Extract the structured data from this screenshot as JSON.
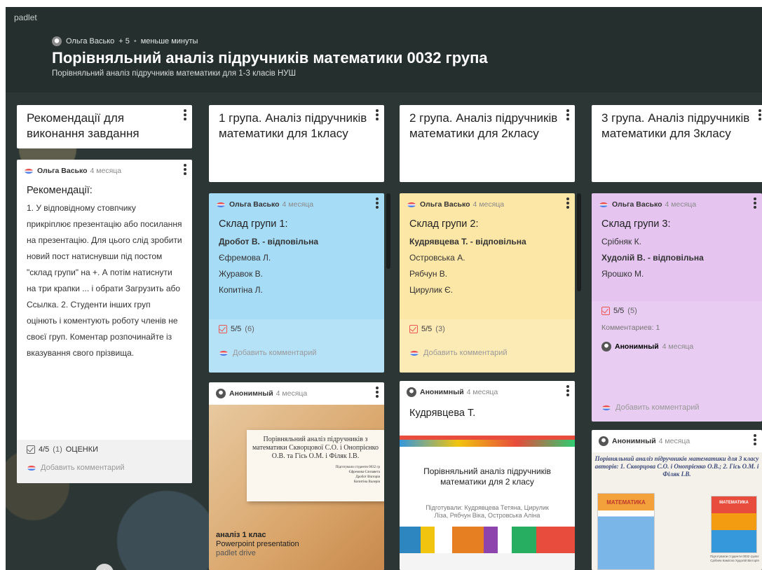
{
  "brand": "padlet",
  "header": {
    "author": "Ольга Васько",
    "contributors": "+ 5",
    "updated": "меньше минуты",
    "title": "Порівняльний аналіз підручників математики 0032 група",
    "subtitle": "Порівняльний аналіз підручників математики для 1-3 класів НУШ"
  },
  "columns": [
    {
      "title": "Рекомендації для виконання завдання"
    },
    {
      "title": "1 група. Аналіз підручників математики для 1класу"
    },
    {
      "title": "2 група. Аналіз підручників математики для 2класу"
    },
    {
      "title": "3 група. Аналіз підручників математики для 3класу"
    }
  ],
  "cards": {
    "rec": {
      "author": "Ольга Васько",
      "time": "4 месяца",
      "title": "Рекомендації:",
      "body": "1. У відповідному стовпчику прикріплює презентацію або посилання на презентацію. Для цього слід зробити новий пост натиснувши під постом \"склад групи\" на +. А потім натиснути на три крапки ... і обрати Загрузить або Ссылка. 2. Студенти інших груп оцінють і коментують роботу членів не своєї груп. Коментар розпочинайте із вказування свого прізвища.",
      "vote": "4/5",
      "vote_count": "(1)",
      "vote_label": "ОЦЕНКИ",
      "add_comment": "Добавить комментарий"
    },
    "g1": {
      "author": "Ольга Васько",
      "time": "4 месяца",
      "title": "Склад групи 1:",
      "members": [
        "Дробот В. - відповільна",
        "Єфремова Л.",
        "Журавок В.",
        "Копитіна Л."
      ],
      "vote": "5/5",
      "vote_count": "(6)",
      "add_comment": "Добавить комментарий",
      "color": "#a7dcf7"
    },
    "g2": {
      "author": "Ольга Васько",
      "time": "4 месяца",
      "title": "Склад групи 2:",
      "members": [
        "Кудрявцева Т. - відповільна",
        "Островська А.",
        "Рябчун В.",
        "Цирулик Є."
      ],
      "vote": "5/5",
      "vote_count": "(3)",
      "add_comment": "Добавить комментарий",
      "color": "#fde7a6"
    },
    "g3": {
      "author": "Ольга Васько",
      "time": "4 месяца",
      "title": "Склад групи 3:",
      "members": [
        "Срібняк К.",
        "Худолій В. - відповільна",
        "Ярошко М."
      ],
      "vote": "5/5",
      "vote_count": "(5)",
      "comments": "Комментариев: 1",
      "comment_author": "Анонимный",
      "comment_time": "4 месяца",
      "add_comment": "Добавить комментарий",
      "color": "#e5c5f0"
    },
    "p1": {
      "author": "Анонимный",
      "time": "4 месяца",
      "slide_title": "Порівняльний аналіз підручників з математики Скворцової С.О. і Онопрієнко О.В. та Гісь О.М. і Філяк І.В.",
      "slide_credits": [
        "Підготували студенти 0032 гр",
        "Єфремова Єлизавета",
        "Дробот Вікторія",
        "Копитіна Валерія"
      ],
      "caption": "аналіз 1 клас",
      "file_type": "Powerpoint presentation",
      "source": "padlet drive"
    },
    "p2": {
      "author": "Анонимный",
      "time": "4 месяца",
      "title": "Кудрявцева Т.",
      "slide_title": "Порівняльний аналіз підручників математики для 2 класу",
      "slide_credits": "Підготували: Кудрявцева Тетяна, Цирулик Ліза, Рябчун Віка, Островська Аліна"
    },
    "p3": {
      "author": "Анонимный",
      "time": "4 месяца",
      "slide_title": "Порівняльний аналіз підручників математики для 3 класу авторів: 1. Скворцова С.О. і Онопрієнко О.В.; 2. Гісь О.М. і Філяк І.В.",
      "book1": "МАТЕМАТИКА",
      "book2": "МАТЕМАТИКА",
      "slide_credits": "Підготували студенти 0032 групи: Срібняк Камілла Худолій Вікторія"
    }
  },
  "add_post_icon": "+"
}
